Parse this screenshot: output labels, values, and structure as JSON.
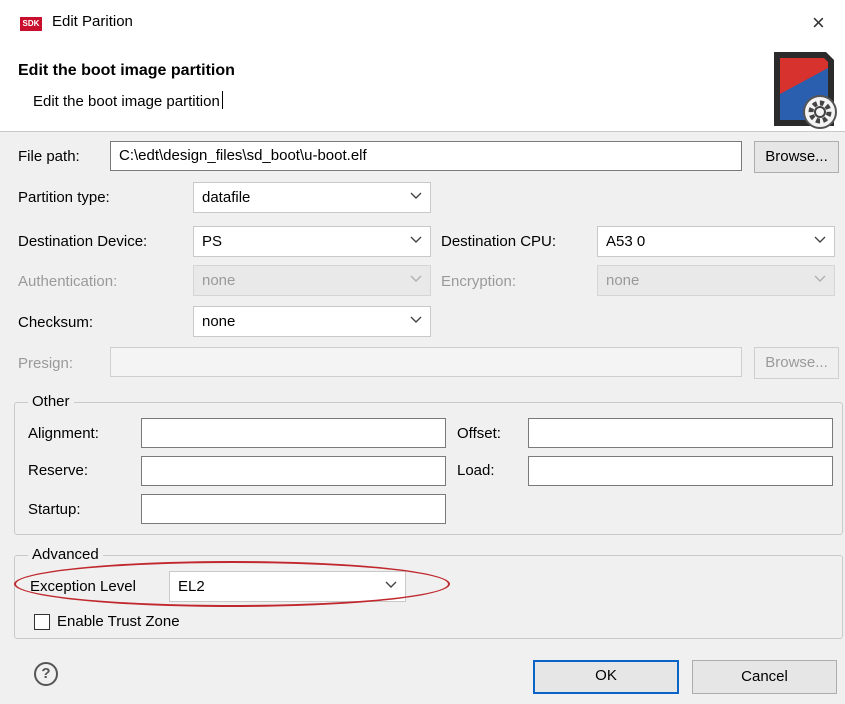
{
  "window": {
    "logo_text": "SDK",
    "title": "Edit Parition",
    "close_glyph": "×"
  },
  "header": {
    "title": "Edit the boot image partition",
    "description": "Edit the boot image partition",
    "banner_icon": "sd-card-gear-icon"
  },
  "file_path": {
    "label": "File path:",
    "value": "C:\\edt\\design_files\\sd_boot\\u-boot.elf",
    "browse_label": "Browse..."
  },
  "partition_type": {
    "label": "Partition type:",
    "value": "datafile"
  },
  "destination_device": {
    "label": "Destination Device:",
    "value": "PS"
  },
  "destination_cpu": {
    "label": "Destination CPU:",
    "value": "A53 0"
  },
  "authentication": {
    "label": "Authentication:",
    "value": "none"
  },
  "encryption": {
    "label": "Encryption:",
    "value": "none"
  },
  "checksum": {
    "label": "Checksum:",
    "value": "none"
  },
  "presign": {
    "label": "Presign:",
    "value": "",
    "browse_label": "Browse..."
  },
  "other": {
    "legend": "Other",
    "alignment": {
      "label": "Alignment:",
      "value": ""
    },
    "offset": {
      "label": "Offset:",
      "value": ""
    },
    "reserve": {
      "label": "Reserve:",
      "value": ""
    },
    "load": {
      "label": "Load:",
      "value": ""
    },
    "startup": {
      "label": "Startup:",
      "value": ""
    }
  },
  "advanced": {
    "legend": "Advanced",
    "exception_level": {
      "label": "Exception Level",
      "value": "EL2"
    },
    "trust_zone": {
      "label": "Enable Trust Zone",
      "checked": false
    }
  },
  "footer": {
    "help_glyph": "?",
    "ok_label": "OK",
    "cancel_label": "Cancel"
  },
  "colors": {
    "highlight_ellipse": "#c0282d",
    "focus_border": "#0a64c8",
    "logo_bg": "#c8102e"
  }
}
